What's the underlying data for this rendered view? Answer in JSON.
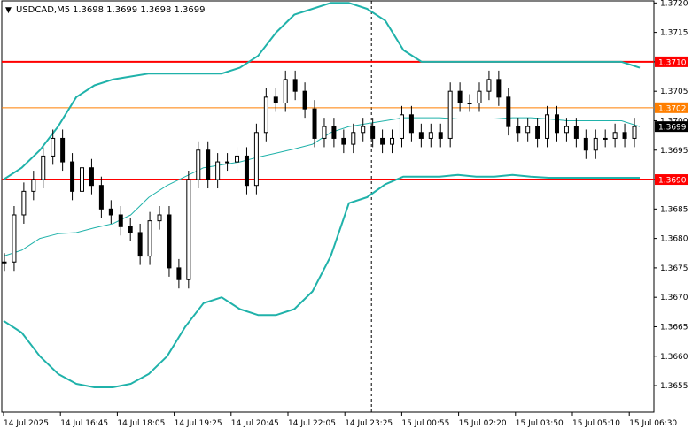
{
  "header": {
    "marker": "▼",
    "symbol": "USDCAD,M5",
    "ohlc": "1.3698 1.3699 1.3698 1.3699"
  },
  "colors": {
    "candle": "#000000",
    "bollinger": "#20b2aa",
    "ma": "#20b2aa",
    "level_red": "#ff0000",
    "level_orange": "#ff7f00",
    "current_price_tag": "#000000",
    "grid_dash": "#000000"
  },
  "chart_data": {
    "type": "candlestick",
    "title": "USDCAD,M5",
    "ylim": [
      1.36505,
      1.37205
    ],
    "y_ticks": [
      "1.3655",
      "1.3660",
      "1.3665",
      "1.3670",
      "1.3675",
      "1.3680",
      "1.3685",
      "1.3690",
      "1.3695",
      "1.3700",
      "1.3705",
      "1.3710",
      "1.3715",
      "1.3720"
    ],
    "x_ticks": [
      "14 Jul 2025",
      "14 Jul 16:45",
      "14 Jul 18:05",
      "14 Jul 19:25",
      "14 Jul 20:45",
      "14 Jul 22:05",
      "14 Jul 23:25",
      "15 Jul 00:55",
      "15 Jul 02:20",
      "15 Jul 03:50",
      "15 Jul 05:10",
      "15 Jul 06:30"
    ],
    "levels": [
      {
        "label": "1.3710",
        "value": 1.371,
        "color": "#ff0000"
      },
      {
        "label": "1.3702",
        "value": 1.37022,
        "color": "#ff7f00"
      },
      {
        "label": "1.3690",
        "value": 1.369,
        "color": "#ff0000"
      }
    ],
    "current_price": {
      "label": "1.3699",
      "value": 1.3699
    },
    "period_separator_after_tick": "14 Jul 23:25",
    "bollinger_upper": [
      1.369,
      1.3692,
      1.3695,
      1.3699,
      1.3704,
      1.3706,
      1.3707,
      1.37075,
      1.3708,
      1.3708,
      1.3708,
      1.3708,
      1.3708,
      1.3709,
      1.3711,
      1.3715,
      1.3718,
      1.3719,
      1.372,
      1.372,
      1.3719,
      1.3717,
      1.3712,
      1.371,
      1.371,
      1.371,
      1.371,
      1.371,
      1.371,
      1.371,
      1.371,
      1.371,
      1.371,
      1.371,
      1.371,
      1.3709
    ],
    "bollinger_lower": [
      1.3666,
      1.3664,
      1.366,
      1.3657,
      1.36553,
      1.36547,
      1.36547,
      1.36553,
      1.3657,
      1.366,
      1.3665,
      1.3669,
      1.367,
      1.3668,
      1.3667,
      1.3667,
      1.3668,
      1.3671,
      1.3677,
      1.3686,
      1.3687,
      1.36892,
      1.36905,
      1.36905,
      1.36905,
      1.36908,
      1.36905,
      1.36905,
      1.36908,
      1.36905,
      1.36903,
      1.36903,
      1.36903,
      1.36903,
      1.36903,
      1.36903
    ],
    "moving_average": [
      1.3677,
      1.3678,
      1.368,
      1.36808,
      1.3681,
      1.36818,
      1.36825,
      1.3684,
      1.3687,
      1.3689,
      1.36905,
      1.3692,
      1.36925,
      1.3693,
      1.36938,
      1.36945,
      1.36952,
      1.3696,
      1.3698,
      1.3699,
      1.36995,
      1.37,
      1.37005,
      1.37005,
      1.37005,
      1.37003,
      1.37003,
      1.37003,
      1.37005,
      1.37005,
      1.37003,
      1.37,
      1.37,
      1.37,
      1.37,
      1.3699
    ],
    "candles_close": [
      1.3676,
      1.3684,
      1.3688,
      1.369,
      1.3694,
      1.3697,
      1.3693,
      1.3688,
      1.3692,
      1.3689,
      1.3685,
      1.3684,
      1.3682,
      1.3681,
      1.3677,
      1.3683,
      1.3684,
      1.3675,
      1.3673,
      1.369,
      1.3695,
      1.369,
      1.3693,
      1.3693,
      1.3694,
      1.3689,
      1.3698,
      1.3704,
      1.3703,
      1.3707,
      1.3705,
      1.3702,
      1.3697,
      1.3699,
      1.3697,
      1.3696,
      1.3698,
      1.3699,
      1.3697,
      1.3696,
      1.3697,
      1.3701,
      1.3698,
      1.3697,
      1.3698,
      1.3697,
      1.3705,
      1.3703,
      1.3703,
      1.3705,
      1.3707,
      1.3704,
      1.3699,
      1.3698,
      1.3699,
      1.3697,
      1.3701,
      1.3698,
      1.3699,
      1.3697,
      1.3695,
      1.3697,
      1.3697,
      1.3698,
      1.3697,
      1.3699
    ]
  }
}
